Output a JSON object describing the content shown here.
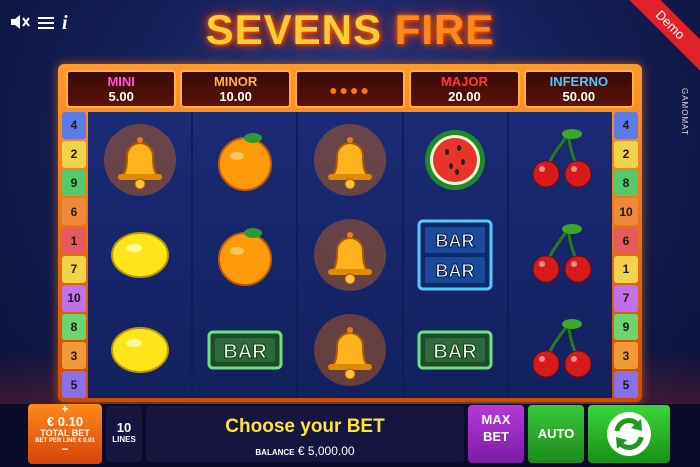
{
  "top": {
    "sound_icon": "speaker-mute-icon",
    "menu_icon": "hamburger-icon",
    "info_icon": "info-icon",
    "title_a": "SEVENS ",
    "title_b": "FIRE",
    "demo": "Demo",
    "brand": "GAMOMAT"
  },
  "jackpots": [
    {
      "name": "MINI",
      "value": "5.00",
      "color": "#ff4fd8"
    },
    {
      "name": "MINOR",
      "value": "10.00",
      "color": "#ffb347"
    },
    {
      "name": "",
      "value": "",
      "color": "#ff7a00"
    },
    {
      "name": "MAJOR",
      "value": "20.00",
      "color": "#ff3a3a"
    },
    {
      "name": "INFERNO",
      "value": "50.00",
      "color": "#4fc8ff"
    }
  ],
  "line_numbers_left": [
    "4",
    "2",
    "9",
    "6",
    "1",
    "7",
    "10",
    "8",
    "3",
    "5"
  ],
  "line_numbers_right": [
    "4",
    "2",
    "8",
    "10",
    "6",
    "1",
    "7",
    "9",
    "3",
    "5"
  ],
  "line_colors": [
    "#5d7be8",
    "#f2d34a",
    "#55c96a",
    "#f08a3a",
    "#e85a5a",
    "#f2d34a",
    "#c070e8",
    "#6fd36f",
    "#f09a3a",
    "#8a70e8"
  ],
  "reels": [
    [
      "bell",
      "lemon",
      "lemon"
    ],
    [
      "orange",
      "orange",
      "bar"
    ],
    [
      "bell",
      "bell",
      "bell"
    ],
    [
      "watermelon",
      "double-bar",
      "bar"
    ],
    [
      "cherries",
      "cherries",
      "cherries"
    ]
  ],
  "bottom": {
    "bet_plus": "+",
    "bet_amount": "€ 0.10",
    "bet_label": "TOTAL BET",
    "bet_per_line": "BET PER LINE € 0.01",
    "bet_minus": "−",
    "lines_value": "10",
    "lines_label": "LINES",
    "message": "Choose your BET",
    "balance_label": "BALANCE",
    "balance_value": "€ 5,000.00",
    "maxbet_1": "MAX",
    "maxbet_2": "BET",
    "auto": "AUTO",
    "spin_icon": "refresh-arrows-icon"
  }
}
